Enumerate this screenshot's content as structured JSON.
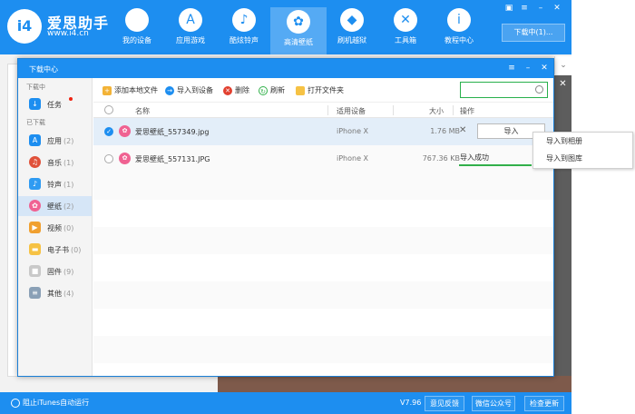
{
  "app": {
    "name": "爱思助手",
    "url": "www.i4.cn",
    "logo_mark": "i4"
  },
  "nav": [
    {
      "label": "我的设备",
      "icon": "apple-icon",
      "glyph": ""
    },
    {
      "label": "应用游戏",
      "icon": "app-store-icon",
      "glyph": "A"
    },
    {
      "label": "酷炫铃声",
      "icon": "bell-icon",
      "glyph": "♪"
    },
    {
      "label": "高清壁纸",
      "icon": "wallpaper-icon",
      "glyph": "✿"
    },
    {
      "label": "刷机越狱",
      "icon": "dropbox-icon",
      "glyph": "◆"
    },
    {
      "label": "工具箱",
      "icon": "tools-icon",
      "glyph": "✕"
    },
    {
      "label": "教程中心",
      "icon": "info-icon",
      "glyph": "i"
    }
  ],
  "download_button": "下载中(1)...",
  "status_bar": {
    "itunes_toggle": "阻止iTunes自动运行",
    "version": "V7.96",
    "buttons": [
      "意见反馈",
      "微信公众号",
      "检查更新"
    ]
  },
  "dialog": {
    "title": "下载中心",
    "sidebar": {
      "section_downloading": "下载中",
      "section_downloaded": "已下载",
      "items": [
        {
          "label": "任务",
          "count": "",
          "icon": "download-icon",
          "color": "#1d8ef0",
          "glyph": "↓"
        },
        {
          "label": "应用",
          "count": "(2)",
          "icon": "app-store-icon",
          "color": "#1d8ef0",
          "glyph": "A"
        },
        {
          "label": "音乐",
          "count": "(1)",
          "icon": "music-icon",
          "color": "#e0513a",
          "glyph": "♫"
        },
        {
          "label": "铃声",
          "count": "(1)",
          "icon": "bell-icon",
          "color": "#2f9bf2",
          "glyph": "♪"
        },
        {
          "label": "壁纸",
          "count": "(2)",
          "icon": "wallpaper-icon",
          "color": "#f06292",
          "glyph": "✿"
        },
        {
          "label": "视频",
          "count": "(0)",
          "icon": "video-icon",
          "color": "#f0a030",
          "glyph": "▶"
        },
        {
          "label": "电子书",
          "count": "(0)",
          "icon": "ebook-icon",
          "color": "#f6c244",
          "glyph": "▬"
        },
        {
          "label": "固件",
          "count": "(9)",
          "icon": "firmware-icon",
          "color": "#c9c9c9",
          "glyph": "■"
        },
        {
          "label": "其他",
          "count": "(4)",
          "icon": "other-icon",
          "color": "#8aa0b6",
          "glyph": "≡"
        }
      ]
    },
    "toolbar": {
      "add_local": "添加本地文件",
      "import_device": "导入到设备",
      "delete": "删除",
      "refresh": "刷新",
      "open_folder": "打开文件夹",
      "search_placeholder": ""
    },
    "columns": {
      "name": "名称",
      "device": "适用设备",
      "size": "大小",
      "action": "操作"
    },
    "rows": [
      {
        "name": "爱思壁纸_557349.jpg",
        "device": "iPhone X",
        "size": "1.76 MB",
        "action": "导入",
        "selected": true
      },
      {
        "name": "爱思壁纸_557131.JPG",
        "device": "iPhone X",
        "size": "767.36 KB",
        "action": "导入成功",
        "selected": false
      }
    ]
  },
  "context_menu": [
    "导入到相册",
    "导入到图库"
  ],
  "colors": {
    "brand": "#1d8ef0",
    "success": "#31b04a"
  }
}
